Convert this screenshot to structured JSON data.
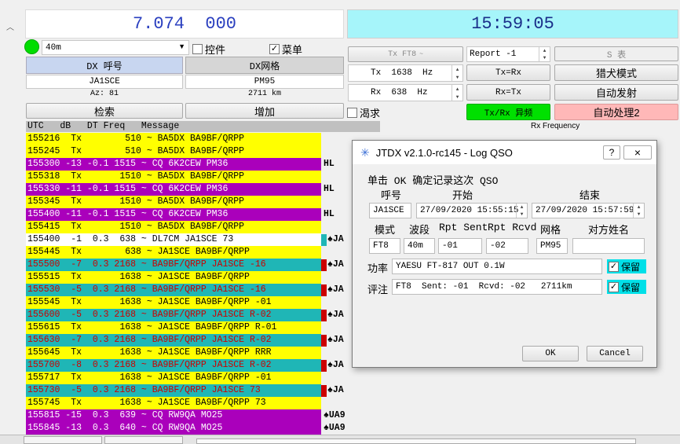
{
  "frequency_display": "7.074  000",
  "clock_display": "15:59:05",
  "band": {
    "selected": "40m"
  },
  "controls_label": "控件",
  "menu_label": "菜单",
  "dx_call_header": "DX 呼号",
  "dx_grid_header": "DX网格",
  "dx_call_value": "JA1SCE",
  "dx_grid_value": "PM95",
  "azimuth": "Az: 81",
  "distance": "2711 km",
  "lookup_button": "检索",
  "add_button": "增加",
  "hound_label": "渴求",
  "tx_mode_button": "Tx FT8",
  "report_value": "Report -1",
  "s_meter_label": "S 表",
  "tx_freq_value": "Tx  1638  Hz",
  "rx_freq_value": "Rx  638  Hz",
  "tx_eq_rx_button": "Tx=Rx",
  "rx_eq_tx_button": "Rx=Tx",
  "hound_mode_button": "猎犬模式",
  "auto_tx_button": "自动发射",
  "txrx_split_button": "Tx/Rx 异频",
  "auto_seq_button": "自动处理2",
  "rx_frequency_label": "Rx Frequency",
  "list_header": "UTC   dB   DT Freq   Message",
  "rows": [
    {
      "text": "155216  Tx        510 ~ BA5DX BA9BF/QRPP",
      "bg": "#ffff00",
      "fg": "#000000"
    },
    {
      "text": "155245  Tx        510 ~ BA5DX BA9BF/QRPP",
      "bg": "#ffff00",
      "fg": "#000000"
    },
    {
      "text": "155300 -13 -0.1 1515 ~ CQ 6K2CEW PM36",
      "bg": "#aa00bb",
      "fg": "#ffffff"
    },
    {
      "text": "155318  Tx       1510 ~ BA5DX BA9BF/QRPP",
      "bg": "#ffff00",
      "fg": "#000000"
    },
    {
      "text": "155330 -11 -0.1 1515 ~ CQ 6K2CEW PM36",
      "bg": "#aa00bb",
      "fg": "#ffffff"
    },
    {
      "text": "155345  Tx       1510 ~ BA5DX BA9BF/QRPP",
      "bg": "#ffff00",
      "fg": "#000000"
    },
    {
      "text": "155400 -11 -0.1 1515 ~ CQ 6K2CEW PM36",
      "bg": "#aa00bb",
      "fg": "#ffffff"
    },
    {
      "text": "155415  Tx       1510 ~ BA5DX BA9BF/QRPP",
      "bg": "#ffff00",
      "fg": "#000000"
    },
    {
      "text": "155400  -1  0.3  638 ~ DL7CM JA1SCE 73",
      "bg": "#ffffff",
      "fg": "#000000"
    },
    {
      "text": "155445  Tx        638 ~ JA1SCE BA9BF/QRPP",
      "bg": "#ffff00",
      "fg": "#000000"
    },
    {
      "text": "155500  -7  0.3 2168 ~ BA9BF/QRPP JA1SCE -16",
      "bg": "#1fb6b6",
      "fg": "#cc0000"
    },
    {
      "text": "155515  Tx       1638 ~ JA1SCE BA9BF/QRPP",
      "bg": "#ffff00",
      "fg": "#000000"
    },
    {
      "text": "155530  -5  0.3 2168 ~ BA9BF/QRPP JA1SCE -16",
      "bg": "#1fb6b6",
      "fg": "#cc0000"
    },
    {
      "text": "155545  Tx       1638 ~ JA1SCE BA9BF/QRPP -01",
      "bg": "#ffff00",
      "fg": "#000000"
    },
    {
      "text": "155600  -5  0.3 2168 ~ BA9BF/QRPP JA1SCE R-02",
      "bg": "#1fb6b6",
      "fg": "#cc0000"
    },
    {
      "text": "155615  Tx       1638 ~ JA1SCE BA9BF/QRPP R-01",
      "bg": "#ffff00",
      "fg": "#000000"
    },
    {
      "text": "155630  -7  0.3 2168 ~ BA9BF/QRPP JA1SCE R-02",
      "bg": "#1fb6b6",
      "fg": "#cc0000"
    },
    {
      "text": "155645  Tx       1638 ~ JA1SCE BA9BF/QRPP RRR",
      "bg": "#ffff00",
      "fg": "#000000"
    },
    {
      "text": "155700  -8  0.3 2168 ~ BA9BF/QRPP JA1SCE R-02",
      "bg": "#1fb6b6",
      "fg": "#cc0000"
    },
    {
      "text": "155717  Tx       1638 ~ JA1SCE BA9BF/QRPP -01",
      "bg": "#ffff00",
      "fg": "#000000"
    },
    {
      "text": "155730  -5  0.3 2168 ~ BA9BF/QRPP JA1SCE 73",
      "bg": "#1fb6b6",
      "fg": "#cc0000"
    },
    {
      "text": "155745  Tx       1638 ~ JA1SCE BA9BF/QRPP 73",
      "bg": "#ffff00",
      "fg": "#000000"
    },
    {
      "text": "155815 -15  0.3  639 ~ CQ RW9QA MO25",
      "bg": "#aa00bb",
      "fg": "#ffffff"
    },
    {
      "text": "155845 -13  0.3  640 ~ CQ RW9QA MO25",
      "bg": "#aa00bb",
      "fg": "#ffffff"
    }
  ],
  "row_tags": [
    {
      "row": 2,
      "text": "HL",
      "marker": ""
    },
    {
      "row": 4,
      "text": "HL",
      "marker": ""
    },
    {
      "row": 6,
      "text": "HL",
      "marker": ""
    },
    {
      "row": 8,
      "text": "♠JA",
      "marker": "#1fb6b6"
    },
    {
      "row": 10,
      "text": "♠JA",
      "marker": "#cc0000"
    },
    {
      "row": 12,
      "text": "♠JA",
      "marker": "#cc0000"
    },
    {
      "row": 14,
      "text": "♠JA",
      "marker": "#cc0000"
    },
    {
      "row": 16,
      "text": "♠JA",
      "marker": "#cc0000"
    },
    {
      "row": 18,
      "text": "♠JA",
      "marker": "#cc0000"
    },
    {
      "row": 20,
      "text": "♠JA",
      "marker": "#cc0000"
    },
    {
      "row": 22,
      "text": "♠UA9",
      "marker": ""
    },
    {
      "row": 23,
      "text": "♠UA9",
      "marker": ""
    }
  ],
  "dialog": {
    "title": "JTDX v2.1.0-rc145 - Log QSO",
    "help": "?",
    "close": "×",
    "instruction": "单击 OK 确定记录这次 QSO",
    "call_label": "呼号",
    "start_label": "开始",
    "end_label": "结束",
    "call_value": "JA1SCE",
    "start_value": "27/09/2020 15:55:15",
    "end_value": "27/09/2020 15:57:59",
    "mode_label": "模式",
    "band_label": "波段",
    "rpt_sent_label": "Rpt Sent",
    "rpt_rcvd_label": "Rpt Rcvd",
    "grid_label": "网格",
    "name_label": "对方姓名",
    "mode_value": "FT8",
    "band_value": "40m",
    "rpt_sent_value": "-01",
    "rpt_rcvd_value": "-02",
    "grid_value": "PM95",
    "name_value": "",
    "power_label": "功率",
    "power_value": "YAESU FT-817 OUT 0.1W",
    "retain_label": "保留",
    "comments_label": "评注",
    "comments_value": "FT8  Sent: -01  Rcvd: -02   2711km",
    "ok_button": "OK",
    "cancel_button": "Cancel"
  },
  "colors": {
    "tx_row": "#ffff00",
    "cq_row": "#aa00bb",
    "to_me_row": "#1fb6b6",
    "split_button": "#00e000",
    "auto_seq_button": "#ffb8b8",
    "clock_bg": "#a6f5fa",
    "freq_text": "#2a3fbf"
  },
  "icons": {
    "status_indicator": "green-circle",
    "dialog_app_icon": "jtdx-star-icon"
  }
}
